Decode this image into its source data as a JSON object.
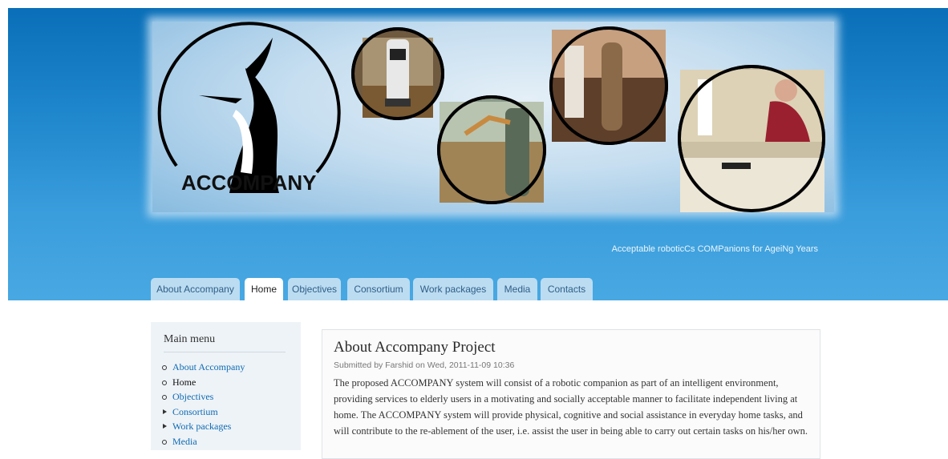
{
  "header": {
    "logo_text": "ACCOMPANY",
    "slogan": "Acceptable roboticCs COMPanions for AgeiNg Years",
    "images": [
      "robot-photo-icon",
      "robot-arm-photo-icon",
      "robot-assist-photo-icon",
      "elderly-woman-photo-icon"
    ]
  },
  "nav": {
    "tabs": [
      {
        "label": "About Accompany"
      },
      {
        "label": "Home"
      },
      {
        "label": "Objectives"
      },
      {
        "label": "Consortium"
      },
      {
        "label": "Work packages"
      },
      {
        "label": "Media"
      },
      {
        "label": "Contacts"
      }
    ],
    "active": "Home"
  },
  "sidebar": {
    "title": "Main menu",
    "items": [
      {
        "label": "About Accompany",
        "marker": "bullet"
      },
      {
        "label": "Home",
        "marker": "bullet"
      },
      {
        "label": "Objectives",
        "marker": "bullet"
      },
      {
        "label": "Consortium",
        "marker": "arrow"
      },
      {
        "label": "Work packages",
        "marker": "arrow"
      },
      {
        "label": "Media",
        "marker": "bullet"
      }
    ]
  },
  "article": {
    "title": "About Accompany Project",
    "submitted": "Submitted by Farshid on Wed, 2011-11-09 10:36",
    "body": "The proposed ACCOMPANY system will consist of a robotic companion as part of an intelligent environment, providing services to elderly users in a motivating and socially acceptable manner to facilitate independent living at home. The ACCOMPANY system will provide physical, cognitive and social assistance in everyday home tasks, and will contribute to the re-ablement of the user, i.e. assist the user in being able to carry out certain tasks on his/her own."
  },
  "colors": {
    "header_top": "#0a6fb8",
    "header_bottom": "#48a8e2",
    "tab_bg": "#bcdcf2",
    "link": "#0e6ab3"
  }
}
